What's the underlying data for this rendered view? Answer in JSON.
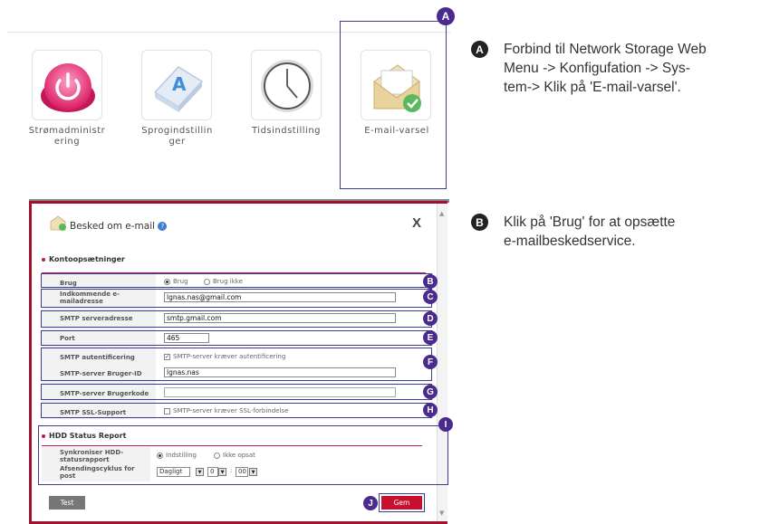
{
  "menu_icons": [
    {
      "label": "Strømadministr ering",
      "icon": "power-icon"
    },
    {
      "label": "Sprogindstillin ger",
      "icon": "language-key-icon"
    },
    {
      "label": "Tidsindstilling",
      "icon": "clock-icon"
    },
    {
      "label": "E-mail-varsel",
      "icon": "email-envelope-icon"
    }
  ],
  "callouts": {
    "A": {
      "letter": "A",
      "text_lines": [
        "Forbind til Network Storage Web",
        "Menu -> Konfigufation -> Sys-",
        "tem-> Klik på 'E-mail-varsel'."
      ]
    },
    "B": {
      "letter": "B",
      "text_lines": [
        "Klik på 'Brug' for at opsætte",
        "e-mailbeskedservice."
      ]
    }
  },
  "dialog": {
    "title": "Besked om e-mail",
    "close": "X",
    "account_section": "Kontoopsætninger",
    "rows": {
      "brug": {
        "label": "Brug",
        "opt_on": "Brug",
        "opt_off": "Brug ikke"
      },
      "incoming": {
        "label1": "Indkommende e-",
        "label2": "mailadresse",
        "value": "lgnas.nas@gmail.com"
      },
      "smtp_server": {
        "label": "SMTP serveradresse",
        "value": "smtp.gmail.com"
      },
      "port": {
        "label": "Port",
        "value": "465"
      },
      "smtp_auth": {
        "label": "SMTP autentificering",
        "option": "SMTP-server kræver autentificering"
      },
      "smtp_user": {
        "label": "SMTP-server Bruger-ID",
        "value": "lgnas.nas"
      },
      "smtp_pass": {
        "label": "SMTP-server Brugerkode",
        "value": ""
      },
      "smtp_ssl": {
        "label": "SMTP SSL-Support",
        "option": "SMTP-server kræver SSL-forbindelse"
      }
    },
    "hdd_section": "HDD Status Report",
    "hdd_rows": {
      "sync": {
        "label1": "Synkroniser HDD-",
        "label2": "statusrapport",
        "opt_on": "Indstilling",
        "opt_off": "Ikke opsat"
      },
      "cycle": {
        "label1": "Afsendingscyklus for",
        "label2": "post",
        "freq": "Dagligt",
        "hour": "0",
        "minute": "00"
      }
    },
    "buttons": {
      "test": "Test",
      "save": "Gem"
    },
    "badges": [
      "B",
      "C",
      "D",
      "E",
      "F",
      "G",
      "H",
      "I",
      "J"
    ]
  },
  "colors": {
    "badge": "#4b2a8e",
    "accent": "#a0122f",
    "save_button": "#c8102e"
  }
}
